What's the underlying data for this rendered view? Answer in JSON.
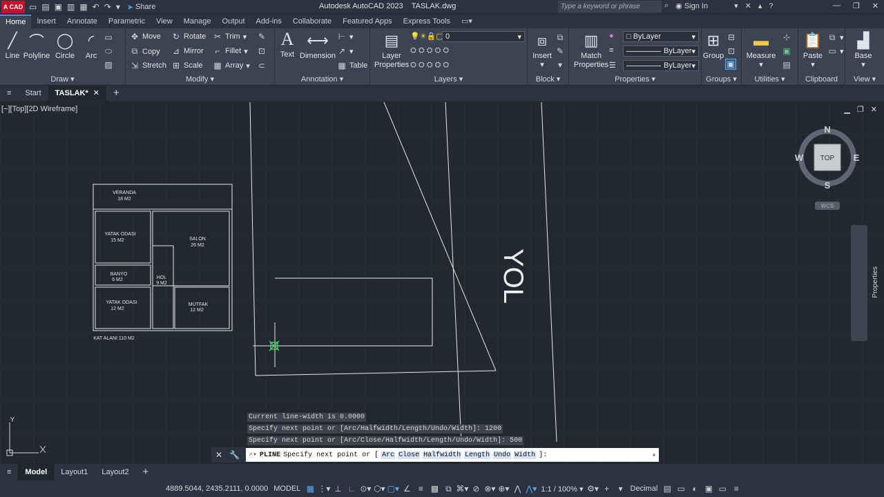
{
  "titlebar": {
    "logo": "A CAD",
    "share": "Share",
    "title": "Autodesk AutoCAD 2023",
    "filename": "TASLAK.dwg",
    "search_placeholder": "Type a keyword or phrase",
    "signin": "Sign In"
  },
  "ribbon_tabs": [
    "Home",
    "Insert",
    "Annotate",
    "Parametric",
    "View",
    "Manage",
    "Output",
    "Add-ins",
    "Collaborate",
    "Featured Apps",
    "Express Tools"
  ],
  "draw": {
    "line": "Line",
    "polyline": "Polyline",
    "circle": "Circle",
    "arc": "Arc",
    "title": "Draw"
  },
  "modify": {
    "move": "Move",
    "rotate": "Rotate",
    "trim": "Trim",
    "copy": "Copy",
    "mirror": "Mirror",
    "fillet": "Fillet",
    "stretch": "Stretch",
    "scale": "Scale",
    "array": "Array",
    "title": "Modify"
  },
  "annotation": {
    "text": "Text",
    "dimension": "Dimension",
    "table": "Table",
    "title": "Annotation"
  },
  "layers": {
    "layer_properties": "Layer Properties",
    "current_layer": "0",
    "title": "Layers"
  },
  "block": {
    "insert": "Insert",
    "title": "Block"
  },
  "properties": {
    "match": "Match Properties",
    "color": "ByLayer",
    "linetype": "ByLayer",
    "lineweight": "ByLayer",
    "title": "Properties"
  },
  "groups": {
    "group": "Group",
    "title": "Groups"
  },
  "utilities": {
    "measure": "Measure",
    "title": "Utilities"
  },
  "clipboard": {
    "paste": "Paste",
    "title": "Clipboard"
  },
  "view": {
    "base": "Base",
    "title": "View"
  },
  "doc_tabs": {
    "start": "Start",
    "active": "TASLAK*"
  },
  "viewport": {
    "label": "[−][Top][2D Wireframe]"
  },
  "viewcube": {
    "n": "N",
    "s": "S",
    "e": "E",
    "w": "W",
    "top": "TOP",
    "wcs": "WCS"
  },
  "side_palette": "Properties",
  "drawing": {
    "rooms": [
      {
        "name": "VERANDA",
        "area": "18 M2"
      },
      {
        "name": "YATAK ODASI",
        "area": "15 M2"
      },
      {
        "name": "SALON",
        "area": "26 M2"
      },
      {
        "name": "BANYO",
        "area": "6 M2"
      },
      {
        "name": "HOL",
        "area": "9 M2"
      },
      {
        "name": "YATAK ODASI",
        "area": "12 M2"
      },
      {
        "name": "MUTFAK",
        "area": "12 M2"
      }
    ],
    "floor_area": "KAT ALANI 110 M2",
    "road_label": "YOL"
  },
  "command_history": [
    "Current line-width is 0.0000",
    "Specify next point or [Arc/Halfwidth/Length/Undo/Width]: 1200",
    "Specify next point or [Arc/Close/Halfwidth/Length/Undo/Width]: 500"
  ],
  "command": {
    "name": "PLINE",
    "prompt": "Specify next point or [",
    "options": [
      "Arc",
      "Close",
      "Halfwidth",
      "Length",
      "Undo",
      "Width"
    ],
    "suffix": "]:"
  },
  "layout_tabs": [
    "Model",
    "Layout1",
    "Layout2"
  ],
  "status": {
    "coords": "4889.5044, 2435.2111, 0.0000",
    "model": "MODEL",
    "scale": "1:1 / 100%",
    "units": "Decimal"
  }
}
